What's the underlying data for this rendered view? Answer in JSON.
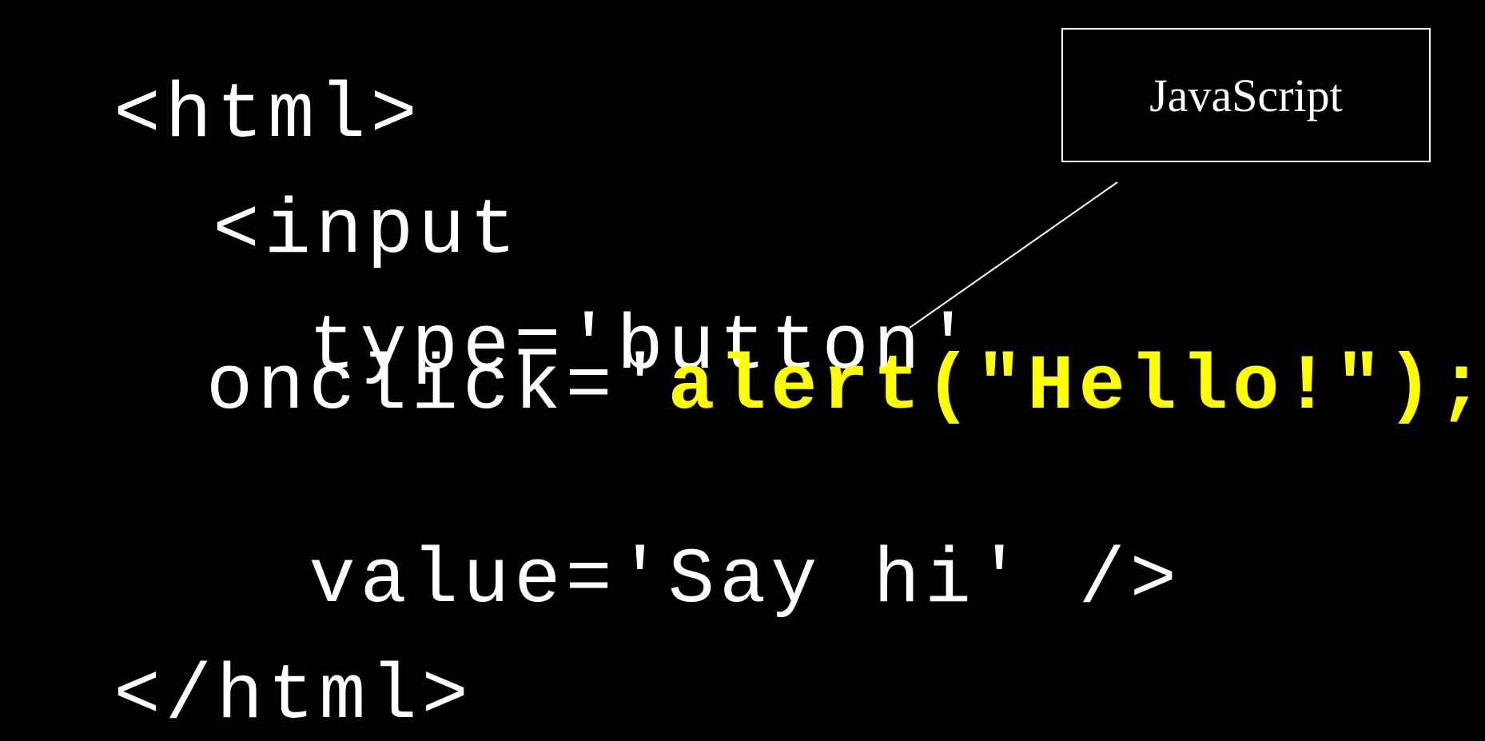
{
  "code": {
    "line_1": "<html>",
    "line_2": "<input",
    "line_3": "type='button'",
    "line_4_prefix": "onclick='",
    "line_4_highlight": "alert(\"Hello!\");",
    "line_4_suffix": "'",
    "line_5": "value='Say hi' />",
    "line_6": "</html>"
  },
  "callout": {
    "label": "JavaScript"
  },
  "colors": {
    "background": "#000000",
    "text": "#ffffff",
    "highlight": "#ffff00"
  }
}
